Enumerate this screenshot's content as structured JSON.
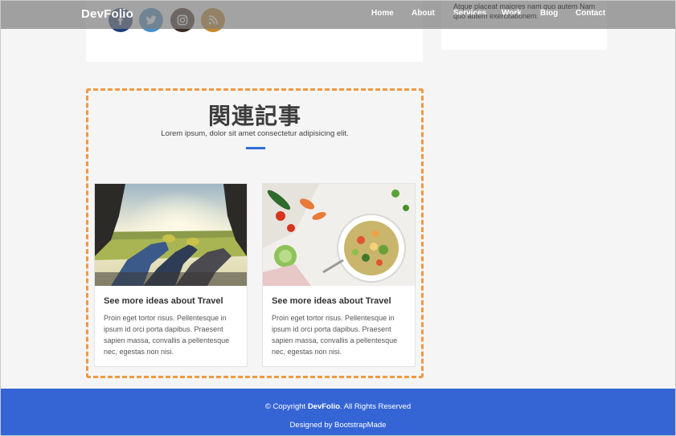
{
  "brand": "DevFolio",
  "nav": [
    "Home",
    "About",
    "Services",
    "Work",
    "Blog",
    "Contact"
  ],
  "social": [
    {
      "icon": "facebook-icon",
      "color": "#1f3f7a"
    },
    {
      "icon": "twitter-icon",
      "color": "#4a90c8"
    },
    {
      "icon": "instagram-icon",
      "color": "#3a2a20"
    },
    {
      "icon": "rss-icon",
      "color": "#c98a2a"
    }
  ],
  "sidebar": {
    "text": "Atque placeat maiores nam quo autem Nam quo autem exercitationem."
  },
  "related": {
    "title": "関連記事",
    "subtitle": "Lorem ipsum, dolor sit amet consectetur adipisicing elit.",
    "cards": [
      {
        "title": "See more ideas about Travel",
        "text": "Proin eget tortor risus. Pellentesque in ipsum id orci porta dapibus. Praesent sapien massa, convallis a pellentesque nec, egestas non nisi."
      },
      {
        "title": "See more ideas about Travel",
        "text": "Proin eget tortor risus. Pellentesque in ipsum id orci porta dapibus. Praesent sapien massa, convallis a pellentesque nec, egestas non nisi."
      }
    ]
  },
  "footer": {
    "copyright_prefix": "© Copyright ",
    "copyright_brand": "DevFolio",
    "copyright_suffix": ". All Rights Reserved",
    "credits": "Designed by BootstrapMade"
  },
  "colors": {
    "accent": "#2f6fdc",
    "footer": "#3565d5",
    "dashed_border": "#ee9a45"
  }
}
